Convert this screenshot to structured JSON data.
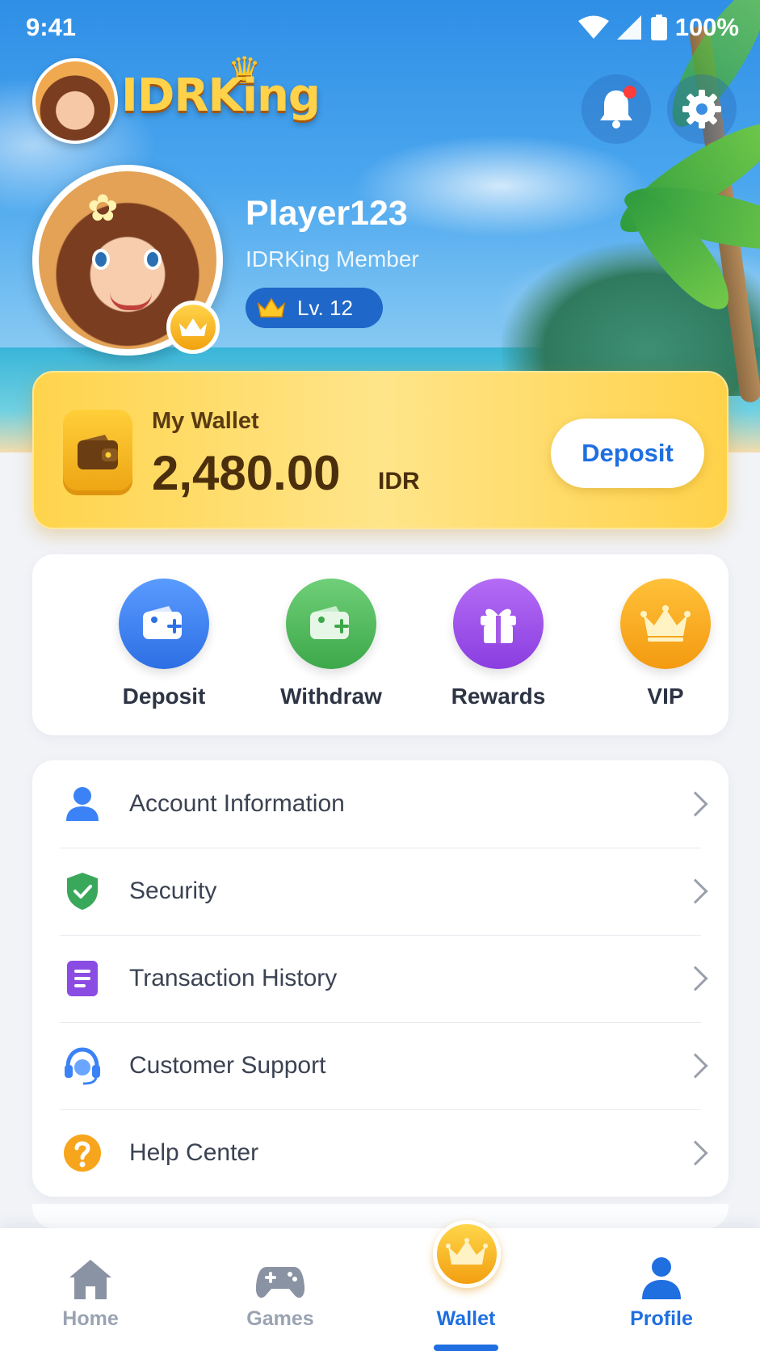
{
  "status_bar": {
    "time": "9:41",
    "battery": "100%"
  },
  "header": {
    "brand": "IDRKing"
  },
  "profile": {
    "username": "Player123",
    "membership": "IDRKing Member",
    "level": "Lv. 12"
  },
  "wallet": {
    "label": "My Wallet",
    "balance": "2,480.00",
    "currency": "IDR",
    "deposit_label": "Deposit"
  },
  "quick_actions": [
    {
      "label": "Deposit",
      "icon": "wallet-plus-icon",
      "color": "#3b82f6"
    },
    {
      "label": "Withdraw",
      "icon": "wallet-out-icon",
      "color": "#4caf50"
    },
    {
      "label": "Rewards",
      "icon": "gift-icon",
      "color": "#9b4de8"
    },
    {
      "label": "VIP",
      "icon": "crown-icon",
      "color": "#f7a51c"
    }
  ],
  "menu": [
    {
      "label": "Account Information",
      "icon": "user-icon"
    },
    {
      "label": "Security",
      "icon": "shield-check-icon"
    },
    {
      "label": "Transaction History",
      "icon": "document-icon"
    },
    {
      "label": "Customer Support",
      "icon": "headset-icon"
    },
    {
      "label": "Help Center",
      "icon": "question-icon"
    }
  ],
  "bottom_nav": [
    {
      "label": "Home",
      "icon": "home-icon",
      "active": false
    },
    {
      "label": "Games",
      "icon": "gamepad-icon",
      "active": false
    },
    {
      "label": "Wallet",
      "icon": "crown-icon",
      "active": true
    },
    {
      "label": "Profile",
      "icon": "user-icon",
      "active": true
    }
  ],
  "colors": {
    "accent": "#1f6fe0",
    "gold": "#ffd44c",
    "background": "#f1f3f7"
  }
}
